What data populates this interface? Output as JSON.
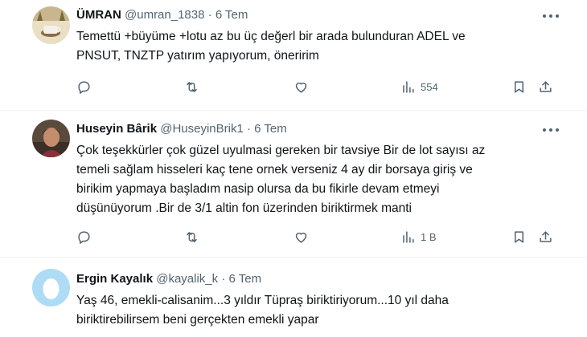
{
  "tweets": [
    {
      "name": "ÜMRAN",
      "handle": "@umran_1838",
      "dot": "·",
      "time": "6 Tem",
      "lines": [
        "Temettü +büyüme +lotu az bu üç değerl bir arada bulunduran ADEL ve",
        "PNSUT, TNZTP  yatırım yapıyorum, öneririm"
      ],
      "views": "554"
    },
    {
      "name": "Huseyin Bârik",
      "handle": "@HuseyinBrik1",
      "dot": "·",
      "time": "6 Tem",
      "lines": [
        "Çok  teşekkürler  çok güzel uyulmasi gereken bir tavsiye Bir de lot sayısı az",
        "temeli  sağlam hisseleri kaç tene ornek verseniz 4 ay dir borsaya giriş ve",
        "birikim yapmaya başladım nasip olursa da bu fikirle devam etmeyi",
        "düşünüyorum .Bir de 3/1 altin fon üzerinden biriktirmek manti"
      ],
      "views": "1 B"
    },
    {
      "name": "Ergin Kayalık",
      "handle": "@kayalik_k",
      "dot": "·",
      "time": "6 Tem",
      "lines": [
        "Yaş 46, emekli-calisanim...3 yıldır Tüpraş biriktiriyorum...10 yıl daha",
        "biriktirebilirsem beni gerçekten emekli yapar"
      ]
    }
  ],
  "colors": {
    "text": "#0f1419",
    "secondary": "#536471",
    "divider": "#eff3f4",
    "default_avatar": "#aedcf5"
  }
}
